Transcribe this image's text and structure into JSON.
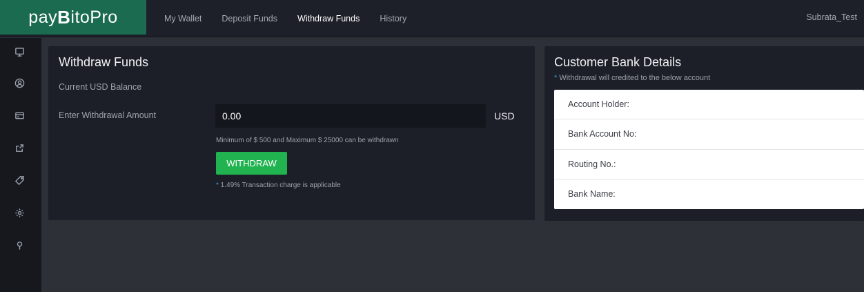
{
  "brand": {
    "pre": "pay",
    "bit": "B",
    "post": "itoPro"
  },
  "nav": {
    "items": [
      {
        "label": "My Wallet"
      },
      {
        "label": "Deposit Funds"
      },
      {
        "label": "Withdraw Funds",
        "active": true
      },
      {
        "label": "History"
      }
    ]
  },
  "user": {
    "name": "Subrata_Test"
  },
  "sidebar": {
    "icons": [
      "monitor-icon",
      "user-circle-icon",
      "card-icon",
      "share-icon",
      "tag-icon",
      "settings-icon",
      "map-pin-icon"
    ]
  },
  "withdraw": {
    "title": "Withdraw Funds",
    "balance_label": "Current USD Balance",
    "amount_label": "Enter Withdrawal Amount",
    "amount_value": "0.00",
    "currency": "USD",
    "limits_hint": "Minimum of $ 500 and Maximum $ 25000 can be withdrawn",
    "button_label": "WITHDRAW",
    "note_star": "*",
    "note_text": " 1.49% Transaction charge is applicable"
  },
  "bank": {
    "title": "Customer Bank Details",
    "sub_star": "*",
    "sub_text": " Withdrawal will credited to the below account",
    "rows": [
      {
        "label": "Account Holder:"
      },
      {
        "label": "Bank Account No:"
      },
      {
        "label": "Routing No.:"
      },
      {
        "label": "Bank Name:"
      }
    ]
  },
  "colors": {
    "logo_bg": "#1b6b50",
    "button": "#21b350",
    "accent_star": "#2a9fd6",
    "page_bg": "#2e3038",
    "panel_bg": "#1c1f28"
  }
}
